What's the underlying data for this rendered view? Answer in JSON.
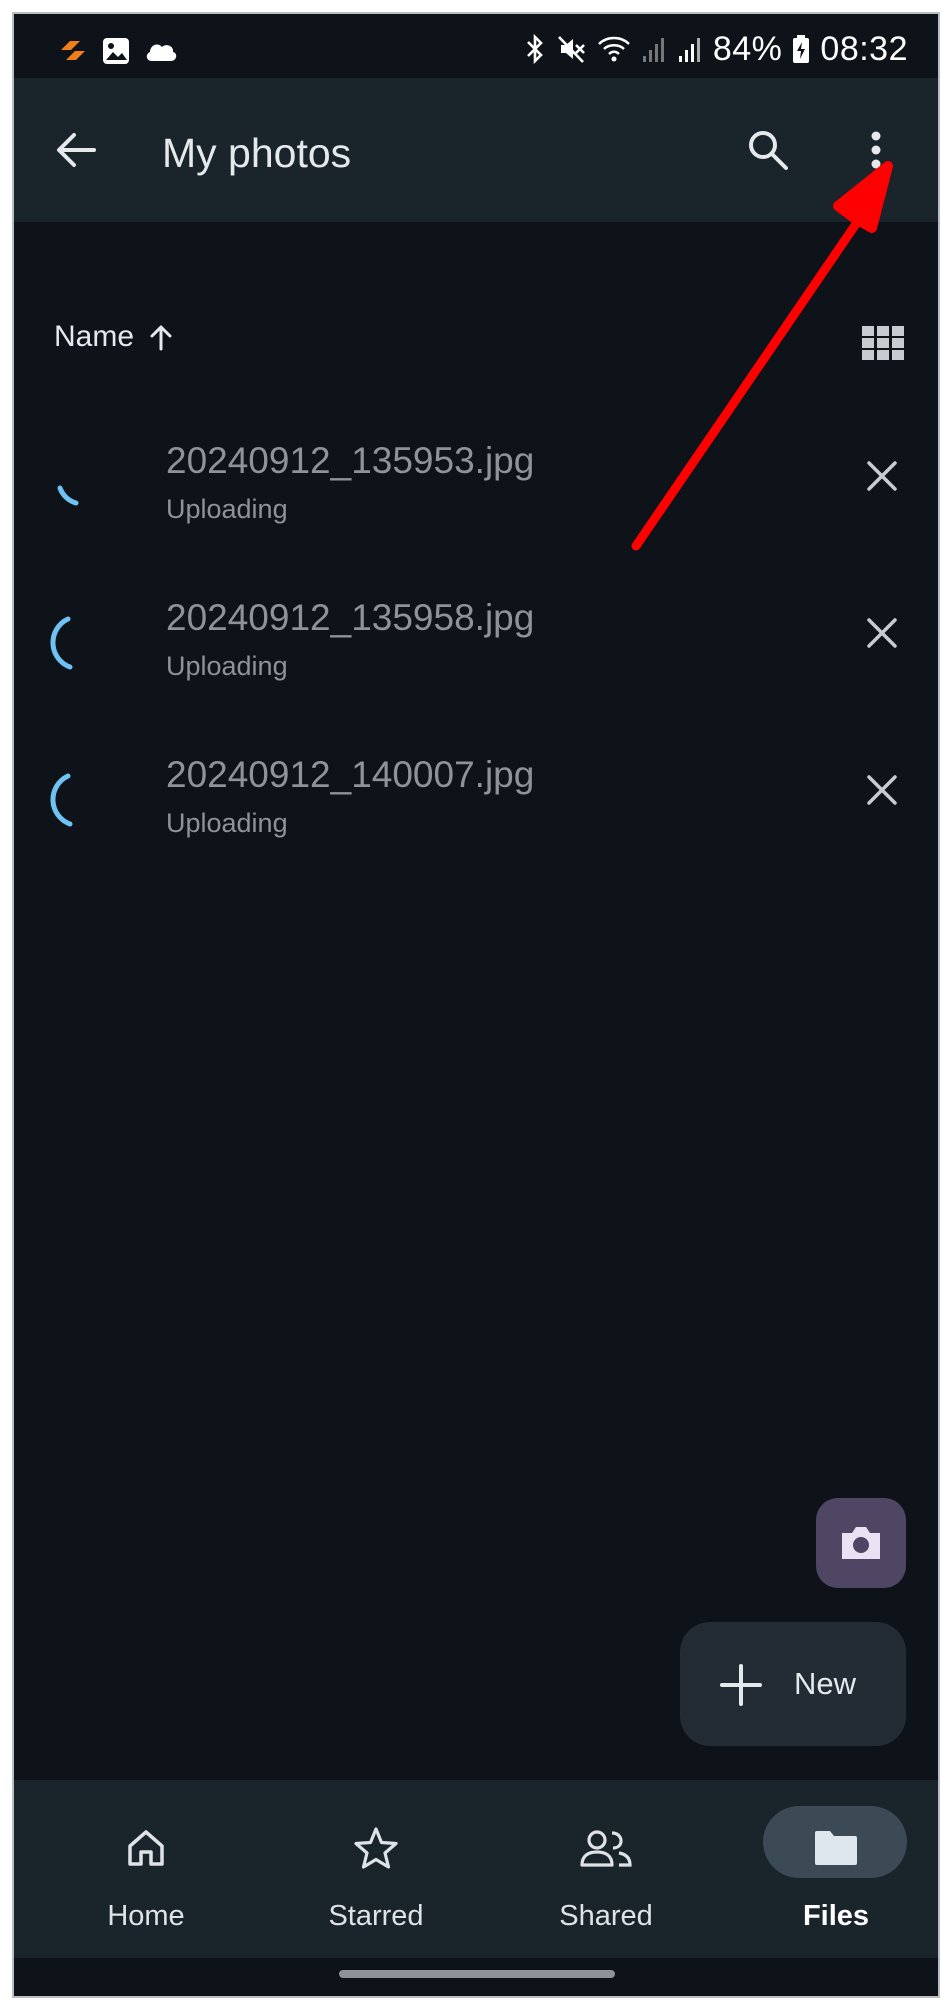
{
  "status_bar": {
    "battery": "84%",
    "time": "08:32",
    "left_icons": [
      "deezer-icon",
      "image-icon",
      "cloud-icon"
    ],
    "right_icons": [
      "bluetooth-icon",
      "mute-icon",
      "wifi-icon",
      "signal-icon",
      "signal-icon",
      "battery-charging-icon"
    ]
  },
  "app_bar": {
    "title": "My photos",
    "back_icon": "arrow-back-icon",
    "search_icon": "search-icon",
    "more_icon": "more-vertical-icon"
  },
  "sort": {
    "label": "Name",
    "direction_icon": "arrow-up-icon",
    "view_toggle_icon": "grid-view-icon"
  },
  "files": [
    {
      "name": "20240912_135953.jpg",
      "status": "Uploading",
      "progress_arc": 0.15
    },
    {
      "name": "20240912_135958.jpg",
      "status": "Uploading",
      "progress_arc": 0.22
    },
    {
      "name": "20240912_140007.jpg",
      "status": "Uploading",
      "progress_arc": 0.22
    }
  ],
  "fab": {
    "camera_icon": "camera-icon",
    "new_label": "New",
    "new_icon": "plus-icon"
  },
  "bottom_nav": {
    "items": [
      {
        "label": "Home",
        "icon": "home-icon",
        "active": false
      },
      {
        "label": "Starred",
        "icon": "star-icon",
        "active": false
      },
      {
        "label": "Shared",
        "icon": "people-icon",
        "active": false
      },
      {
        "label": "Files",
        "icon": "folder-icon",
        "active": true
      }
    ]
  },
  "colors": {
    "background": "#0e131a",
    "app_bar": "#1a242b",
    "spinner": "#6ec3f4",
    "annotation_arrow": "#ff0000",
    "camera_fab": "#4f4663"
  }
}
